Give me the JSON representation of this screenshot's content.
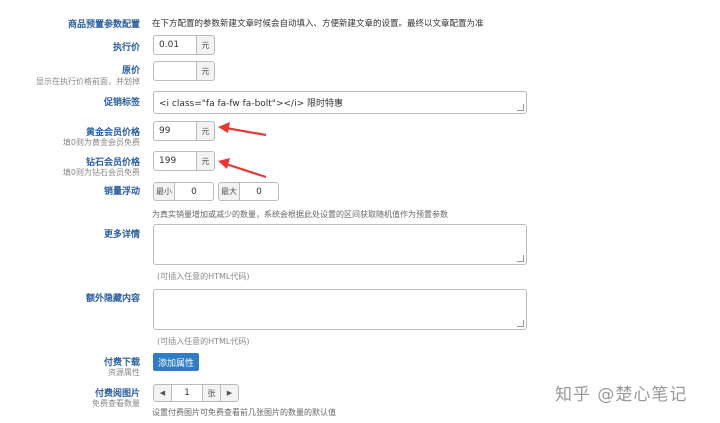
{
  "section": {
    "title": "商品预置参数配置",
    "description": "在下方配置的参数新建文章时候会自动填入、方便新建文章的设置。最终以文章配置为准"
  },
  "exec_price": {
    "label": "执行价",
    "value": "0.01",
    "unit": "元"
  },
  "original_price": {
    "label": "原价",
    "sublabel": "显示在执行价格前面，并划掉",
    "value": "",
    "unit": "元"
  },
  "promo_tag": {
    "label": "促销标签",
    "value": "<i class=\"fa fa-fw fa-bolt\"></i> 限时特惠"
  },
  "gold_price": {
    "label": "黄金会员价格",
    "sublabel": "填0则为黄金会员免费",
    "value": "99",
    "unit": "元"
  },
  "diamond_price": {
    "label": "钻石会员价格",
    "sublabel": "填0则为钻石会员免费",
    "value": "199",
    "unit": "元"
  },
  "sales_float": {
    "label": "销量浮动",
    "min_label": "最小",
    "min_value": "0",
    "max_label": "最大",
    "max_value": "0",
    "help": "为真实销量增加或减少的数量，系统会根据此处设置的区间获取随机值作为预置参数"
  },
  "more_details": {
    "label": "更多详情",
    "help": "(可插入任意的HTML代码)"
  },
  "extra_hidden": {
    "label": "额外隐藏内容",
    "help": "(可插入任意的HTML代码)"
  },
  "paid_download": {
    "label": "付费下载",
    "sublabel": "资源属性",
    "button": "添加属性"
  },
  "paid_images": {
    "label": "付费阅图片",
    "sublabel": "免费查看数量",
    "value": "1",
    "unit": "张",
    "dec": "◀",
    "inc": "▶",
    "help": "设置付费图片可免费查看前几张图片的数量的默认值"
  },
  "watermark": "知乎 @楚心笔记",
  "colors": {
    "label": "#2b5f9e",
    "button": "#2f7dc4",
    "arrow": "#e53935"
  }
}
